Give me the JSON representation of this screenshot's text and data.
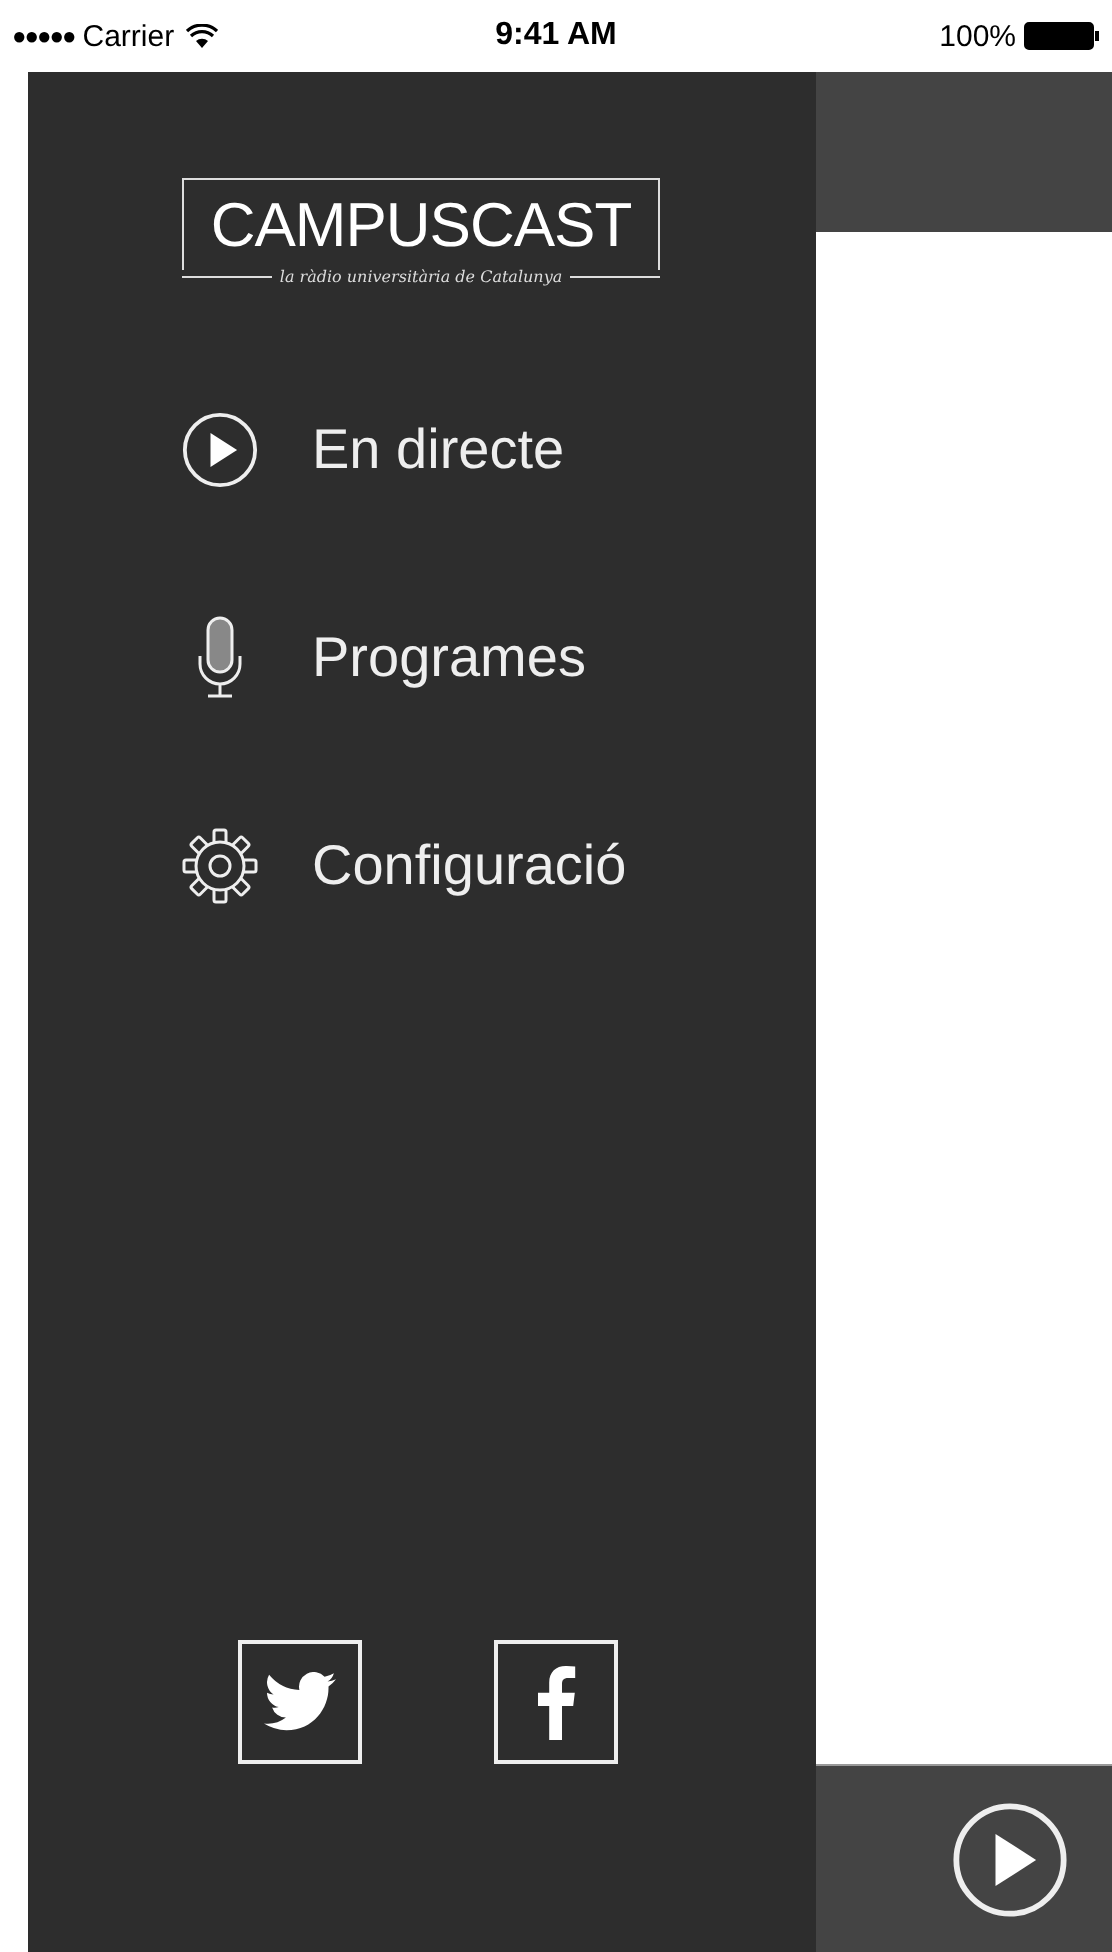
{
  "status_bar": {
    "signal": "●●●●●",
    "carrier": "Carrier",
    "time": "9:41 AM",
    "battery": "100%"
  },
  "logo": {
    "title": "CAMPUSCAST",
    "subtitle": "la ràdio universitària de Catalunya"
  },
  "menu": [
    {
      "kind": "play",
      "label": "En directe"
    },
    {
      "kind": "mic",
      "label": "Programes"
    },
    {
      "kind": "gear",
      "label": "Configuració"
    }
  ],
  "social": [
    {
      "kind": "twitter"
    },
    {
      "kind": "facebook"
    }
  ]
}
